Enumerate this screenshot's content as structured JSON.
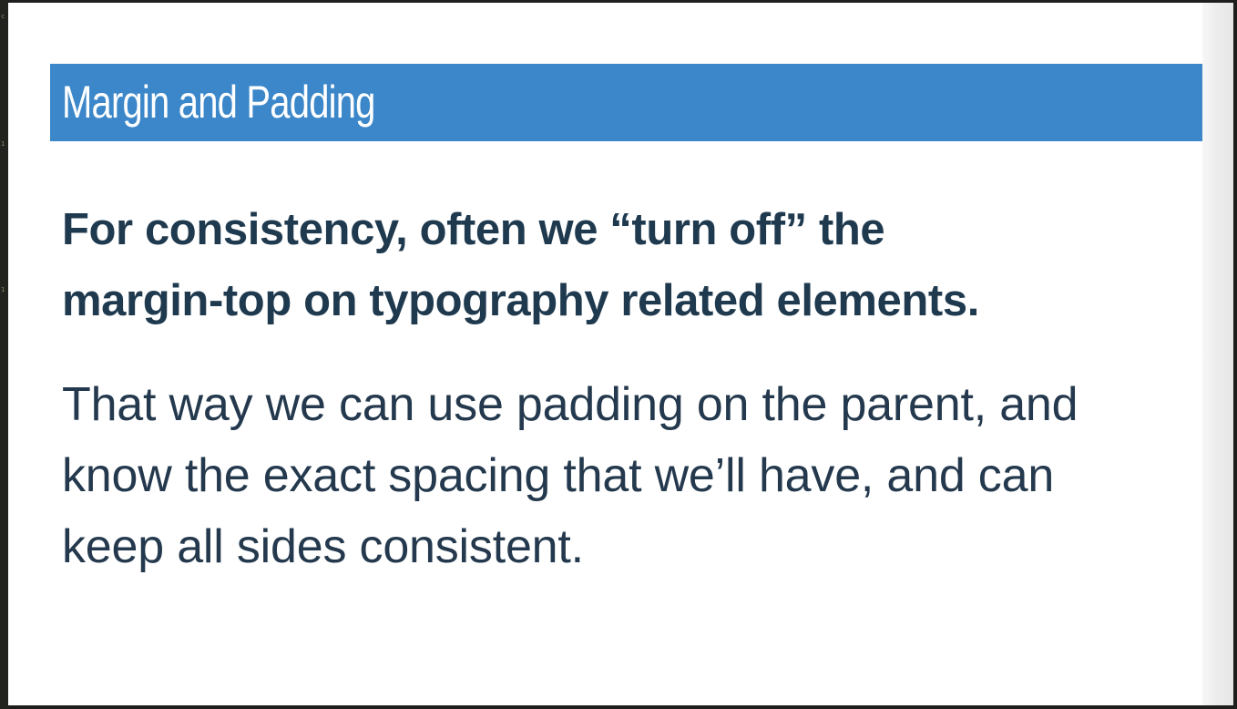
{
  "gutter": {
    "marks": [
      "c",
      "1",
      "1"
    ]
  },
  "slide": {
    "title": "Margin and Padding",
    "lead_line_1": "For consistency, often we “turn off” the",
    "lead_line_2": "margin-top on typography related elements.",
    "body_line_1": "That way we can use padding on the parent, and",
    "body_line_2": "know the exact spacing that we’ll have, and can",
    "body_line_3": "keep all sides consistent."
  },
  "colors": {
    "title_bar": "#3b87c9",
    "title_text": "#ffffff",
    "lead_text": "#1f3a4f",
    "body_text": "#24394d",
    "slide_background": "#ffffff",
    "frame": "#1e1f1c"
  }
}
